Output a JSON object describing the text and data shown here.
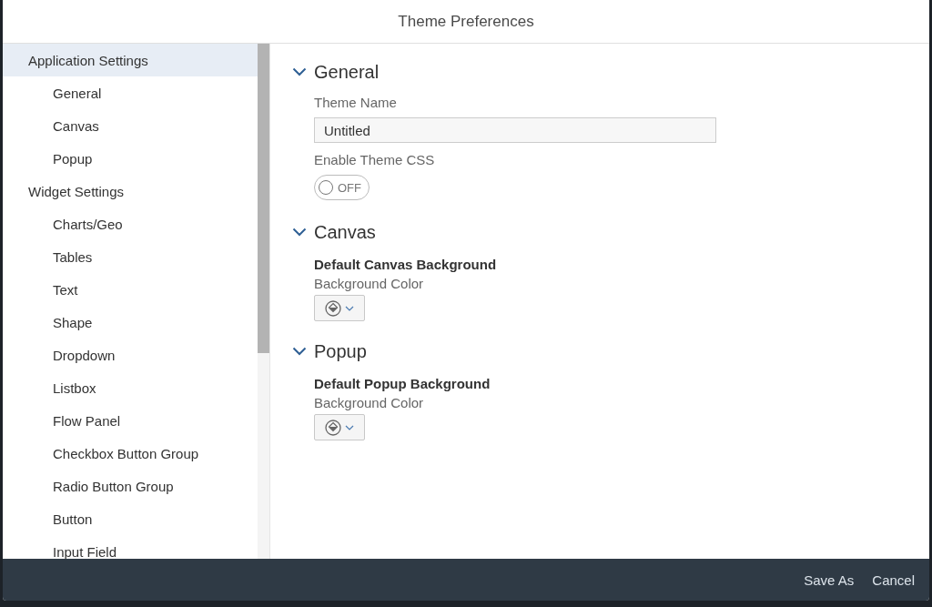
{
  "window": {
    "title": "Theme Preferences"
  },
  "sidebar": {
    "items": [
      {
        "label": "Application Settings",
        "selected": true,
        "children": [
          {
            "label": "General",
            "selected": false
          },
          {
            "label": "Canvas",
            "selected": false
          },
          {
            "label": "Popup",
            "selected": false
          }
        ]
      },
      {
        "label": "Widget Settings",
        "selected": false,
        "children": [
          {
            "label": "Charts/Geo",
            "selected": false
          },
          {
            "label": "Tables",
            "selected": false
          },
          {
            "label": "Text",
            "selected": false
          },
          {
            "label": "Shape",
            "selected": false
          },
          {
            "label": "Dropdown",
            "selected": false
          },
          {
            "label": "Listbox",
            "selected": false
          },
          {
            "label": "Flow Panel",
            "selected": false
          },
          {
            "label": "Checkbox Button Group",
            "selected": false
          },
          {
            "label": "Radio Button Group",
            "selected": false
          },
          {
            "label": "Button",
            "selected": false
          },
          {
            "label": "Input Field",
            "selected": false
          }
        ]
      }
    ]
  },
  "sections": [
    {
      "title": "General",
      "expanded": true,
      "items": [
        {
          "kind": "text",
          "label": "Theme Name",
          "value": "Untitled"
        },
        {
          "kind": "toggle",
          "label": "Enable Theme CSS",
          "on": false,
          "state_text": "OFF"
        }
      ]
    },
    {
      "title": "Canvas",
      "expanded": true,
      "items": [
        {
          "kind": "color",
          "heading": "Default Canvas Background",
          "label": "Background Color"
        }
      ]
    },
    {
      "title": "Popup",
      "expanded": true,
      "items": [
        {
          "kind": "color",
          "heading": "Default Popup Background",
          "label": "Background Color"
        }
      ]
    }
  ],
  "footer": {
    "buttons": [
      "Save As",
      "Cancel"
    ]
  }
}
